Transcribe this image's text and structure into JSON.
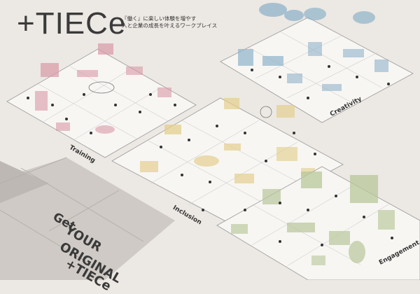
{
  "brand": {
    "logo_text": "+TIECe",
    "tagline_line1": "『働く』に楽しい体験を増やす",
    "tagline_line2": "人と企業の成長を叶えるワークプレイス"
  },
  "zones": {
    "training": "Training",
    "creativity": "Creativity",
    "inclusion": "Inclusion",
    "engagement": "Engagement"
  },
  "cta": {
    "line1": "Get",
    "line2": "YOUR",
    "line3": "ORIGINAL",
    "line4": "+TIECe"
  },
  "colors": {
    "background": "#ece8e3",
    "floor": "#f7f6f3",
    "training_accent": "#d99aa6",
    "creativity_accent": "#8fb3c9",
    "inclusion_accent": "#e4cf8e",
    "engagement_accent": "#b8c79a",
    "cta_floor": "#c9c4bf"
  }
}
